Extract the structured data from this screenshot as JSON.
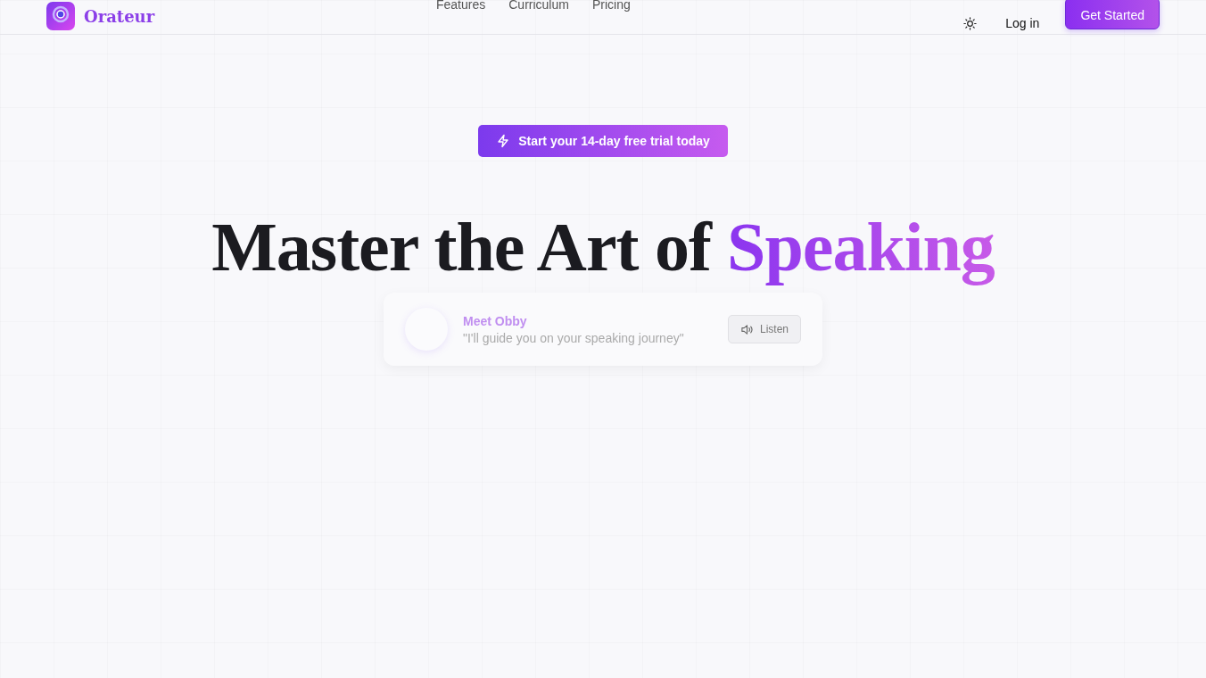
{
  "header": {
    "brand": "Orateur",
    "nav": [
      {
        "label": "Features"
      },
      {
        "label": "Curriculum"
      },
      {
        "label": "Pricing"
      }
    ],
    "login": "Log in",
    "cta": "Get Started"
  },
  "hero": {
    "badge": "Start your 14-day free trial today",
    "title": "Master the Art of",
    "title_highlight": "Speaking",
    "mascot": {
      "name": "Meet Obby",
      "quote": "\"I'll guide you on your speaking journey\"",
      "listen": "Listen"
    }
  }
}
